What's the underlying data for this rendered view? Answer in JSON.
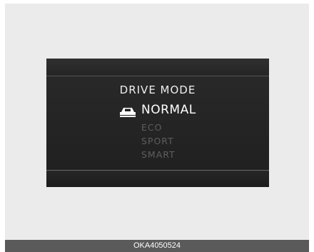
{
  "display": {
    "title": "DRIVE MODE",
    "options": [
      {
        "label": "NORMAL",
        "selected": true,
        "icon": "car-icon"
      },
      {
        "label": "ECO",
        "selected": false
      },
      {
        "label": "SPORT",
        "selected": false
      },
      {
        "label": "SMART",
        "selected": false
      }
    ]
  },
  "caption": {
    "code": "OKA4050524"
  },
  "colors": {
    "display_bg": "#222222",
    "selected_text": "#ffffff",
    "unselected_text": "#5e5e5e",
    "caption_bar": "#5a5a5a"
  }
}
